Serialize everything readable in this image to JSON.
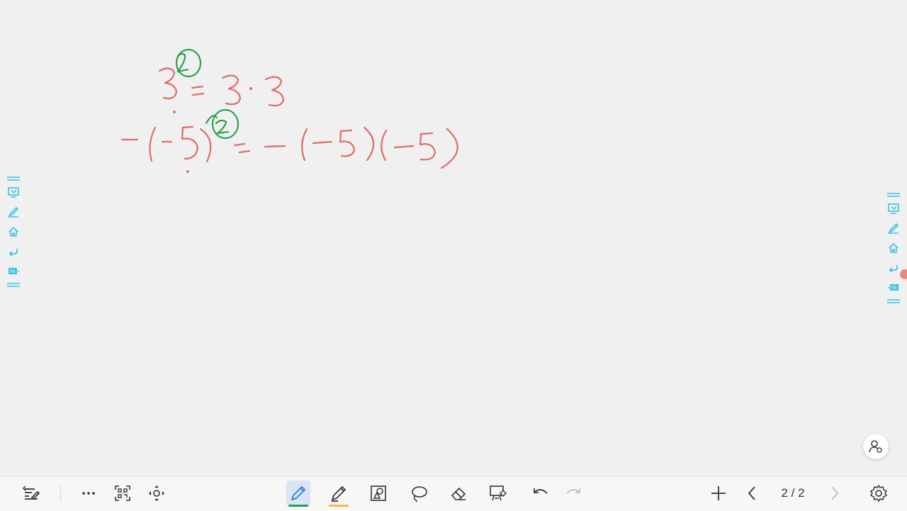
{
  "whiteboard": {
    "ink_colors": {
      "red": "#e06c64",
      "green": "#1a9e3a"
    },
    "side_icons": [
      "menu-icon",
      "whiteboard-icon",
      "pen-icon",
      "home-icon",
      "back-icon",
      "ppt-icon",
      "menu-icon"
    ]
  },
  "toolbar": {
    "page_indicator": "2 / 2",
    "active_tool": "pen",
    "pen_color": "#2a9d54",
    "highlighter_color": "#f5b942",
    "accent": "#2d7fd3"
  }
}
